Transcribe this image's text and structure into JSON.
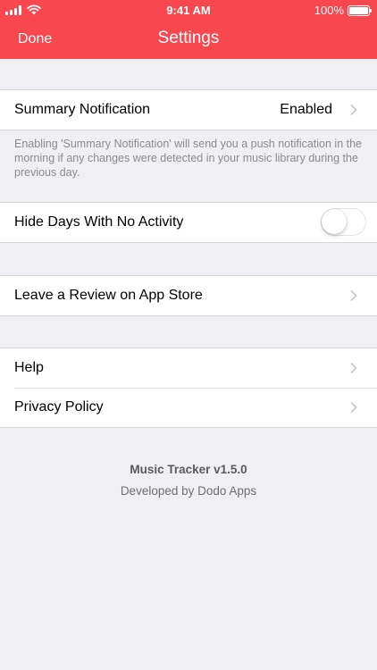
{
  "status_bar": {
    "time": "9:41 AM",
    "battery_percent": "100%",
    "battery_level": 1.0
  },
  "nav": {
    "done_label": "Done",
    "title": "Settings"
  },
  "sections": {
    "notifications": {
      "label": "Summary Notification",
      "value": "Enabled",
      "footnote": "Enabling 'Summary Notification' will send you a push notification in the morning if any changes were detected in your music library during the previous day."
    },
    "activity": {
      "label": "Hide Days With No Activity",
      "toggle_on": false
    },
    "review": {
      "label": "Leave a Review on App Store"
    },
    "support": {
      "help_label": "Help",
      "privacy_label": "Privacy Policy"
    }
  },
  "footer": {
    "app_version": "Music Tracker v1.5.0",
    "developer": "Developed by Dodo Apps"
  },
  "colors": {
    "accent": "#f8474f",
    "background": "#efeff4",
    "chevron": "#c7c7cc"
  },
  "icons": [
    "cellular-signal-icon",
    "wifi-icon",
    "battery-icon",
    "chevron-right-icon"
  ]
}
